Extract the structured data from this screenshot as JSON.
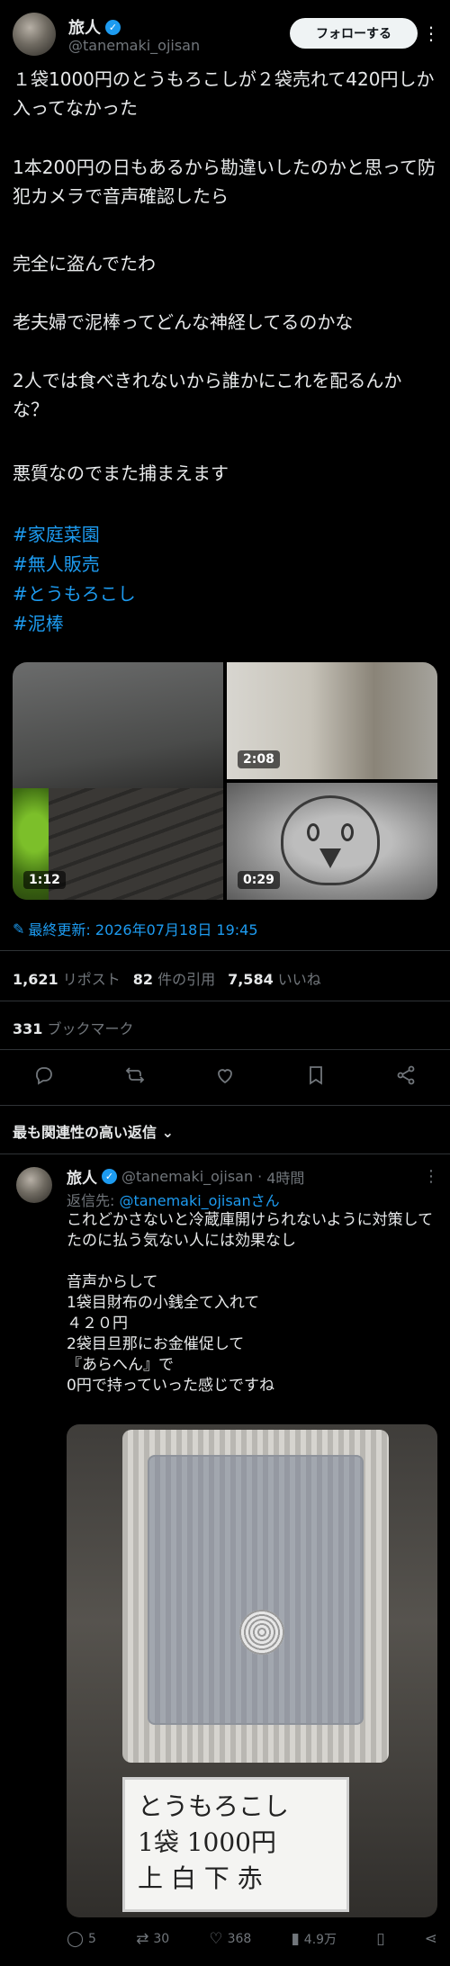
{
  "tweet": {
    "author_name": "旅人",
    "author_handle": "@tanemaki_ojisan",
    "follow_label": "フォローする",
    "paragraphs": [
      "１袋1000円のとうもろこしが２袋売れて420円しか入ってなかった",
      "1本200円の日もあるから勘違いしたのかと思って防犯カメラで音声確認したら",
      "完全に盗んでたわ",
      "老夫婦で泥棒ってどんな神経してるのかな",
      "2人では食べきれないから誰かにこれを配るんかな？",
      "悪質なのでまた捕まえます"
    ],
    "hashtags": [
      "#家庭菜園",
      "#無人販売",
      "#とうもろこし",
      "#泥棒"
    ],
    "media": [
      {
        "duration": "1:12"
      },
      {
        "duration": "2:08"
      },
      {
        "duration": "0:29"
      }
    ],
    "edited_label": "最終更新: 2026年07月18日 19:45",
    "stats": {
      "reposts_count": "1,621",
      "reposts_label": "リポスト",
      "quotes_count": "82",
      "quotes_label": "件の引用",
      "likes_count": "7,584",
      "likes_label": "いいね",
      "bookmarks_count": "331",
      "bookmarks_label": "ブックマーク"
    },
    "icons": [
      "reply-icon",
      "repost-icon",
      "like-icon",
      "bookmark-icon",
      "share-icon"
    ]
  },
  "sort_label": "最も関連性の高い返信",
  "reply": {
    "author_name": "旅人",
    "author_handle": "@tanemaki_ojisan",
    "time": "4時間",
    "replying_prefix": "返信先:",
    "replying_to": "@tanemaki_ojisanさん",
    "text": "これどかさないと冷蔵庫開けられないように対策してたのに払う気ない人には効果なし\n\n音声からして\n1袋目財布の小銭全て入れて\n４２０円\n2袋目旦那にお金催促して\n『あらへん』で\n0円で持っていった感じですね",
    "sign_lines": [
      "とうもろこし",
      "1袋 1000円",
      "上 白 下 赤"
    ],
    "actions": {
      "replies": "5",
      "reposts": "30",
      "likes": "368",
      "views": "4.9万"
    }
  },
  "colors": {
    "background": "#000000",
    "accent": "#1d9bf0",
    "muted": "#71767b",
    "text": "#e7e9ea"
  }
}
